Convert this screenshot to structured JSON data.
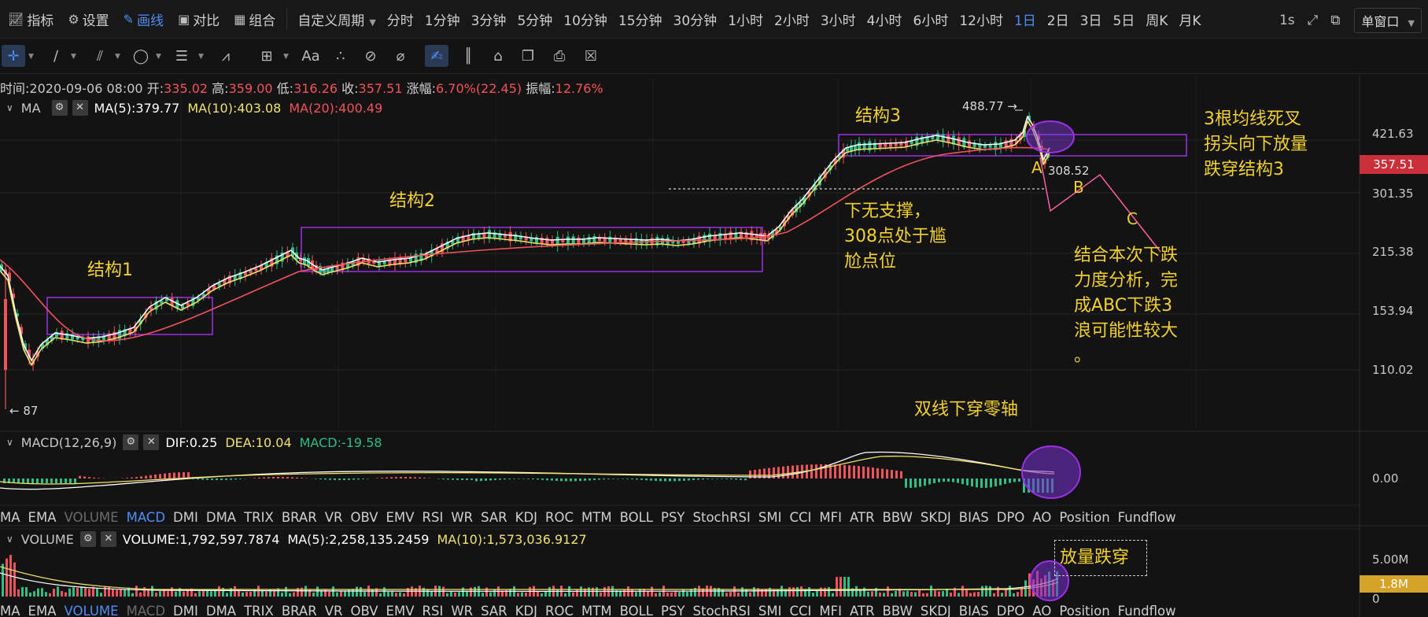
{
  "toolbar": {
    "items": [
      {
        "label": "指标",
        "icon": "chart-indicator-icon"
      },
      {
        "label": "设置",
        "icon": "gear-icon"
      },
      {
        "label": "画线",
        "icon": "pencil-icon",
        "active": true
      },
      {
        "label": "对比",
        "icon": "compare-icon"
      },
      {
        "label": "组合",
        "icon": "grid-icon"
      }
    ],
    "custom_period": "自定义周期",
    "periods": [
      "分时",
      "1分钟",
      "3分钟",
      "5分钟",
      "10分钟",
      "15分钟",
      "30分钟",
      "1小时",
      "2小时",
      "3小时",
      "4小时",
      "6小时",
      "12小时",
      "1日",
      "2日",
      "3日",
      "5日",
      "周K",
      "月K"
    ],
    "active_period": "1日",
    "interval_label": "1s",
    "window_mode": "单窗口"
  },
  "draw_tools": [
    "crosshair-icon",
    "trend-line-icon",
    "parallel-channel-icon",
    "ellipse-icon",
    "horizontal-lines-icon",
    "fibonacci-icon",
    "measure-icon",
    "text-icon",
    "brush-icon",
    "eraser-icon",
    "ruler-icon",
    "draw-mode-icon",
    "candle-pattern-icon",
    "lock-icon",
    "copy-icon",
    "screenshot-icon",
    "trash-icon"
  ],
  "info": {
    "time_label": "时间:",
    "time": "2020-09-06 08:00",
    "open_label": "开:",
    "open": "335.02",
    "high_label": "高:",
    "high": "359.00",
    "low_label": "低:",
    "low": "316.26",
    "close_label": "收:",
    "close": "357.51",
    "change_label": "涨幅:",
    "change": "6.70%(22.45)",
    "amplitude_label": "振幅:",
    "amplitude": "12.76%"
  },
  "ma_legend": {
    "name": "MA",
    "ma5": "MA(5):379.77",
    "ma10": "MA(10):403.08",
    "ma20": "MA(20):400.49"
  },
  "price_axis": [
    "421.63",
    "301.35",
    "215.38",
    "153.94",
    "110.02"
  ],
  "current_price": "357.51",
  "high_marker": "488.77 →",
  "low_marker": "← 87",
  "level_label": "308.52",
  "annotations": {
    "s1": "结构1",
    "s2": "结构2",
    "s3": "结构3",
    "no_support": [
      "下无支撑，",
      "308点处于尴",
      "尬点位"
    ],
    "death_cross": [
      "3根均线死叉",
      "拐头向下放量",
      "跌穿结构3"
    ],
    "abc": [
      "结合本次下跌",
      "力度分析，完",
      "成ABC下跌3",
      "浪可能性较大",
      "。"
    ],
    "wave_a": "A",
    "wave_b": "B",
    "wave_c": "C",
    "zero_axis": "双线下穿零轴",
    "volume_break": "放量跌穿"
  },
  "macd_legend": {
    "name": "MACD(12,26,9)",
    "dif": "DIF:0.25",
    "dea": "DEA:10.04",
    "macd": "MACD:-19.58"
  },
  "macd_axis": "0.00",
  "indicator_tabs": [
    "MA",
    "EMA",
    "VOLUME",
    "MACD",
    "DMI",
    "DMA",
    "TRIX",
    "BRAR",
    "VR",
    "OBV",
    "EMV",
    "RSI",
    "WR",
    "SAR",
    "KDJ",
    "ROC",
    "MTM",
    "BOLL",
    "PSY",
    "StochRSI",
    "SMI",
    "CCI",
    "MFI",
    "ATR",
    "BBW",
    "SKDJ",
    "BIAS",
    "DPO",
    "AO",
    "Position",
    "Fundflow"
  ],
  "active_tab": "MACD",
  "dim_tab": "VOLUME",
  "volume_legend": {
    "name": "VOLUME",
    "value": "VOLUME:1,792,597.7874",
    "ma5": "MA(5):2,258,135.2459",
    "ma10": "MA(10):1,573,036.9127"
  },
  "volume_axis": "5.00M",
  "volume_tag": "1.8M",
  "indicator_tabs_bottom_active": "VOLUME",
  "indicator_tabs_bottom_dim": "MACD",
  "colors": {
    "up": "#2ebd85",
    "down": "#f0535b",
    "accent": "#4f8ef7",
    "annotation": "#f2d12c",
    "box": "#9b30e6",
    "ma5": "#ffffff",
    "ma10": "#f2e26b",
    "ma20": "#f0535b"
  }
}
